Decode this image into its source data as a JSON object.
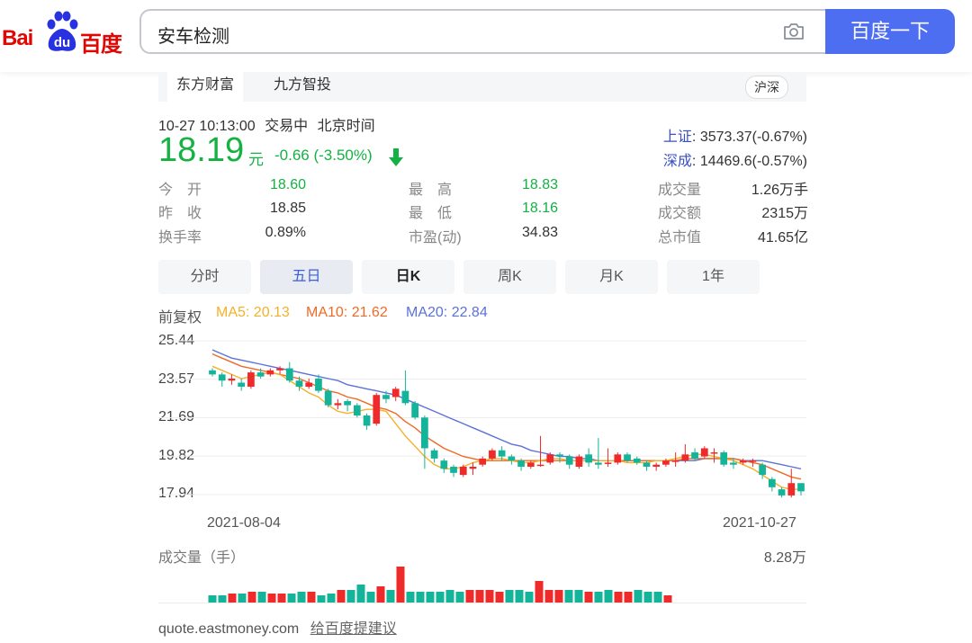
{
  "header": {
    "logo": {
      "left": "Bai",
      "middle": "du",
      "right": "百度"
    },
    "search_query": "安车检测",
    "search_button": "百度一下",
    "camera_icon": "camera-icon"
  },
  "stock": {
    "sources": [
      "东方财富",
      "九方智投"
    ],
    "market": "沪深",
    "timestamp": "10-27 10:13:00",
    "status": "交易中",
    "timezone": "北京时间",
    "price": "18.19",
    "unit": "元",
    "change": "-0.66 (-3.50%)",
    "indices": [
      {
        "name": "上证",
        "value": ": 3573.37(-0.67%)"
      },
      {
        "name": "深成",
        "value": ": 14469.6(-0.57%)"
      }
    ],
    "stats": [
      [
        {
          "label": "今　开",
          "value": "18.60",
          "color": "#14b143"
        },
        {
          "label": "最　高",
          "value": "18.83",
          "color": "#14b143"
        },
        {
          "label": "成交量",
          "value": "1.26万手",
          "color": "#333333"
        }
      ],
      [
        {
          "label": "昨　收",
          "value": "18.85",
          "color": "#333333"
        },
        {
          "label": "最　低",
          "value": "18.16",
          "color": "#14b143"
        },
        {
          "label": "成交额",
          "value": "2315万",
          "color": "#333333"
        }
      ],
      [
        {
          "label": "换手率",
          "value": "0.89%",
          "color": "#333333"
        },
        {
          "label": "市盈(动)",
          "value": "34.83",
          "color": "#333333"
        },
        {
          "label": "总市值",
          "value": "41.65亿",
          "color": "#333333"
        }
      ]
    ]
  },
  "period_tabs": [
    "分时",
    "五日",
    "日K",
    "周K",
    "月K",
    "1年"
  ],
  "active_period": "日K",
  "legend": {
    "adjust": "前复权",
    "ma5": "MA5: 20.13",
    "ma10": "MA10: 21.62",
    "ma20": "MA20: 22.84",
    "colors": {
      "ma5": "#f5b128",
      "ma10": "#f06a25",
      "ma20": "#5b72d8",
      "up": "#ee2a2a",
      "down": "#14b49a"
    }
  },
  "chart_data": {
    "type": "candlestick",
    "y_ticks": [
      "25.44",
      "23.57",
      "21.69",
      "19.82",
      "17.94"
    ],
    "ylim": [
      17.94,
      25.44
    ],
    "x_labels": [
      "2021-08-04",
      "2021-10-27"
    ],
    "candles": [
      [
        24.0,
        23.8,
        24.1,
        23.7
      ],
      [
        23.8,
        23.5,
        23.9,
        23.2
      ],
      [
        23.5,
        23.6,
        23.8,
        23.3
      ],
      [
        23.4,
        23.2,
        23.6,
        23.0
      ],
      [
        23.2,
        23.9,
        24.0,
        23.1
      ],
      [
        23.9,
        23.7,
        24.1,
        23.6
      ],
      [
        23.8,
        24.0,
        24.1,
        23.7
      ],
      [
        24.0,
        24.1,
        24.2,
        23.8
      ],
      [
        24.1,
        23.5,
        24.4,
        23.4
      ],
      [
        23.5,
        23.2,
        23.7,
        23.0
      ],
      [
        23.2,
        23.4,
        23.6,
        23.1
      ],
      [
        23.6,
        23.0,
        23.8,
        22.9
      ],
      [
        23.0,
        22.3,
        23.1,
        22.2
      ],
      [
        22.3,
        22.4,
        22.6,
        22.1
      ],
      [
        22.5,
        22.3,
        22.6,
        22.0
      ],
      [
        22.3,
        21.8,
        22.4,
        21.7
      ],
      [
        21.8,
        21.3,
        21.9,
        21.1
      ],
      [
        21.4,
        22.8,
        22.9,
        21.3
      ],
      [
        22.8,
        22.6,
        23.0,
        22.4
      ],
      [
        22.7,
        23.1,
        23.2,
        22.5
      ],
      [
        23.0,
        22.4,
        24.0,
        22.3
      ],
      [
        22.4,
        21.7,
        22.5,
        21.6
      ],
      [
        21.7,
        20.2,
        21.8,
        19.2
      ],
      [
        20.1,
        19.7,
        20.2,
        19.5
      ],
      [
        19.6,
        19.2,
        19.7,
        19.0
      ],
      [
        19.3,
        19.0,
        19.4,
        18.8
      ],
      [
        18.9,
        19.3,
        19.4,
        18.8
      ],
      [
        19.2,
        19.3,
        19.5,
        18.9
      ],
      [
        19.4,
        19.7,
        19.8,
        19.3
      ],
      [
        19.7,
        20.1,
        20.2,
        19.6
      ],
      [
        20.1,
        19.8,
        20.3,
        19.6
      ],
      [
        19.8,
        19.6,
        19.9,
        19.4
      ],
      [
        19.6,
        19.3,
        19.7,
        19.1
      ],
      [
        19.3,
        19.5,
        19.6,
        19.2
      ],
      [
        19.4,
        19.4,
        20.8,
        19.3
      ],
      [
        19.5,
        19.9,
        20.0,
        19.4
      ],
      [
        19.9,
        19.8,
        20.0,
        19.5
      ],
      [
        19.8,
        19.4,
        19.9,
        19.2
      ],
      [
        19.3,
        19.8,
        19.9,
        19.2
      ],
      [
        19.9,
        19.5,
        20.2,
        19.3
      ],
      [
        19.5,
        19.4,
        20.7,
        19.2
      ],
      [
        19.5,
        19.5,
        20.2,
        19.3
      ],
      [
        19.5,
        19.9,
        20.0,
        19.4
      ],
      [
        19.9,
        19.6,
        20.0,
        19.5
      ],
      [
        19.7,
        19.5,
        19.8,
        19.4
      ],
      [
        19.5,
        19.3,
        19.6,
        19.1
      ],
      [
        19.3,
        19.4,
        19.5,
        19.1
      ],
      [
        19.4,
        19.6,
        19.7,
        19.3
      ],
      [
        19.6,
        19.6,
        20.0,
        19.3
      ],
      [
        19.6,
        19.9,
        20.4,
        19.5
      ],
      [
        20.0,
        19.7,
        20.2,
        19.6
      ],
      [
        19.8,
        20.2,
        20.3,
        19.7
      ],
      [
        20.0,
        20.0,
        20.2,
        19.5
      ],
      [
        20.0,
        19.4,
        20.1,
        19.3
      ],
      [
        19.5,
        19.4,
        19.7,
        19.2
      ],
      [
        19.5,
        19.6,
        19.7,
        19.4
      ],
      [
        19.6,
        19.6,
        19.7,
        19.3
      ],
      [
        19.4,
        18.9,
        19.5,
        18.7
      ],
      [
        18.7,
        18.3,
        18.8,
        18.1
      ],
      [
        18.2,
        17.9,
        18.3,
        17.8
      ],
      [
        17.9,
        18.5,
        19.2,
        17.8
      ],
      [
        18.5,
        18.1,
        18.5,
        17.9
      ]
    ],
    "ma5": [
      24.2,
      24.0,
      23.8,
      23.6,
      23.7,
      23.8,
      23.9,
      23.8,
      23.5,
      23.2,
      22.9,
      22.7,
      22.3,
      22.0,
      21.9,
      22.0,
      22.1,
      22.1,
      22.0,
      21.4,
      20.8,
      20.3,
      19.8,
      19.4,
      19.2,
      19.2,
      19.3,
      19.5,
      19.6,
      19.7,
      19.7,
      19.6,
      19.5,
      19.5,
      19.6,
      19.7,
      19.7,
      19.6,
      19.6,
      19.6,
      19.6,
      19.6,
      19.6,
      19.5,
      19.5,
      19.5,
      19.6,
      19.6,
      19.7,
      19.8,
      19.9,
      19.9,
      19.8,
      19.7,
      19.6,
      19.4,
      19.2,
      18.9,
      18.6,
      18.3,
      18.2,
      18.2
    ],
    "ma10": [
      24.8,
      24.6,
      24.4,
      24.2,
      24.1,
      24.0,
      23.9,
      23.8,
      23.7,
      23.6,
      23.4,
      23.2,
      23.0,
      22.9,
      22.7,
      22.6,
      22.4,
      22.2,
      22.1,
      21.9,
      21.5,
      21.2,
      20.8,
      20.5,
      20.2,
      20.0,
      19.8,
      19.7,
      19.6,
      19.6,
      19.6,
      19.6,
      19.6,
      19.6,
      19.6,
      19.6,
      19.6,
      19.6,
      19.6,
      19.6,
      19.6,
      19.6,
      19.6,
      19.6,
      19.6,
      19.6,
      19.6,
      19.6,
      19.6,
      19.7,
      19.7,
      19.7,
      19.7,
      19.7,
      19.7,
      19.6,
      19.5,
      19.4,
      19.2,
      19.0,
      18.8,
      18.7
    ],
    "ma20": [
      25.0,
      24.8,
      24.6,
      24.5,
      24.4,
      24.3,
      24.2,
      24.1,
      24.0,
      23.9,
      23.8,
      23.7,
      23.6,
      23.5,
      23.3,
      23.2,
      23.1,
      23.0,
      22.9,
      22.8,
      22.6,
      22.4,
      22.2,
      22.0,
      21.8,
      21.6,
      21.4,
      21.2,
      21.0,
      20.8,
      20.6,
      20.4,
      20.3,
      20.1,
      20.0,
      19.9,
      19.8,
      19.8,
      19.7,
      19.7,
      19.6,
      19.6,
      19.6,
      19.6,
      19.6,
      19.6,
      19.6,
      19.6,
      19.6,
      19.6,
      19.6,
      19.7,
      19.7,
      19.7,
      19.7,
      19.6,
      19.6,
      19.6,
      19.5,
      19.4,
      19.3,
      19.2
    ]
  },
  "volume": {
    "title": "成交量（手）",
    "max": "8.28万",
    "bars": [
      0.2,
      0.2,
      0.25,
      0.25,
      0.3,
      0.3,
      0.25,
      0.25,
      0.25,
      0.3,
      0.3,
      0.2,
      0.25,
      0.35,
      0.35,
      0.5,
      0.3,
      0.45,
      0.35,
      1.0,
      0.3,
      0.3,
      0.3,
      0.3,
      0.35,
      0.3,
      0.35,
      0.35,
      0.35,
      0.3,
      0.35,
      0.35,
      0.3,
      0.6,
      0.35,
      0.35,
      0.35,
      0.35,
      0.3,
      0.3,
      0.35,
      0.3,
      0.3,
      0.35,
      0.3,
      0.3,
      0.2
    ]
  },
  "footer": {
    "source": "quote.eastmoney.com",
    "feedback": "给百度提建议"
  }
}
